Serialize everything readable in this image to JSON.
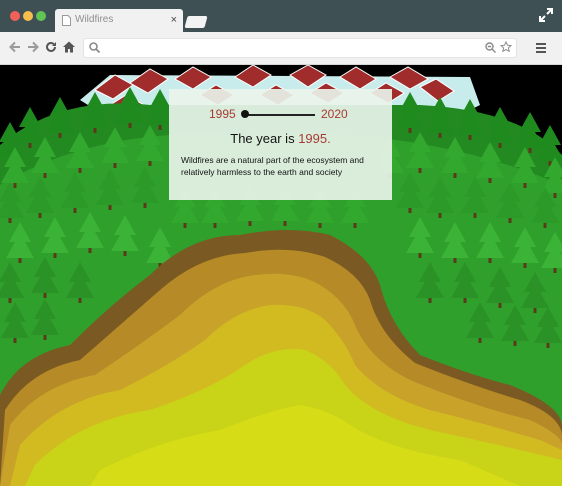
{
  "browser": {
    "tab_title": "Wildfires",
    "tab_close": "×",
    "address": "",
    "icons": [
      "page-icon",
      "close-icon",
      "fullscreen-icon",
      "back-icon",
      "forward-icon",
      "reload-icon",
      "home-icon",
      "search-icon",
      "zoom-icon",
      "star-icon",
      "menu-icon"
    ]
  },
  "viz": {
    "slider": {
      "start_label": "1995",
      "end_label": "2020",
      "value": 1995
    },
    "headline_prefix": "The year is ",
    "headline_year": "1995.",
    "description": "Wildfires are a natural part of the ecosystem and relatively harmless to the earth and society",
    "colors": {
      "accent": "#a83a33",
      "forest": "#2f9a2a",
      "burn_yellow": "#c9d418",
      "burn_orange": "#c99a22",
      "burn_brown": "#7a5a22",
      "house_roof": "#9b2d2d"
    }
  }
}
